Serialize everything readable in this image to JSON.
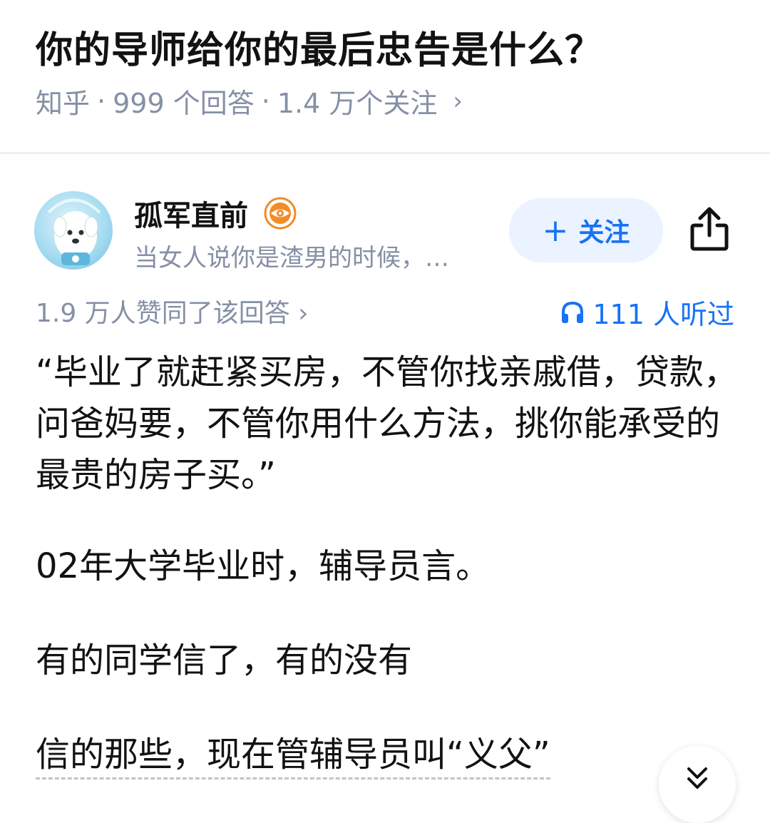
{
  "question": {
    "title": "你的导师给你的最后忠告是什么？",
    "source": "知乎",
    "answers": "999 个回答",
    "followers": "1.4 万个关注",
    "separator": "·",
    "chevron": "›"
  },
  "author": {
    "name": "孤军直前",
    "bio": "当女人说你是渣男的时候，…",
    "follow_label": "关注",
    "follow_plus": "+",
    "avatar_icon": "astronaut-dog-avatar",
    "badge_icon": "eye-badge-icon",
    "share_icon": "share-icon"
  },
  "stats": {
    "upvotes": "1.9 万人赞同了该回答 ›",
    "listened": "111 人听过",
    "listen_icon": "headphones-icon"
  },
  "answer": {
    "paragraphs": [
      "“毕业了就赶紧买房，不管你找亲戚借，贷款，问爸妈要，不管你用什么方法，挑你能承受的最贵的房子买。”",
      "02年大学毕业时，辅导员言。",
      "有的同学信了，有的没有",
      "信的那些，现在管辅导员叫“义父”"
    ]
  },
  "expand_icon": "double-chevron-down-icon",
  "colors": {
    "accent": "#1772f6",
    "follow_bg": "#eaf3ff",
    "meta_gray": "#8590a6",
    "text": "#121212",
    "badge": "#f28c28"
  }
}
